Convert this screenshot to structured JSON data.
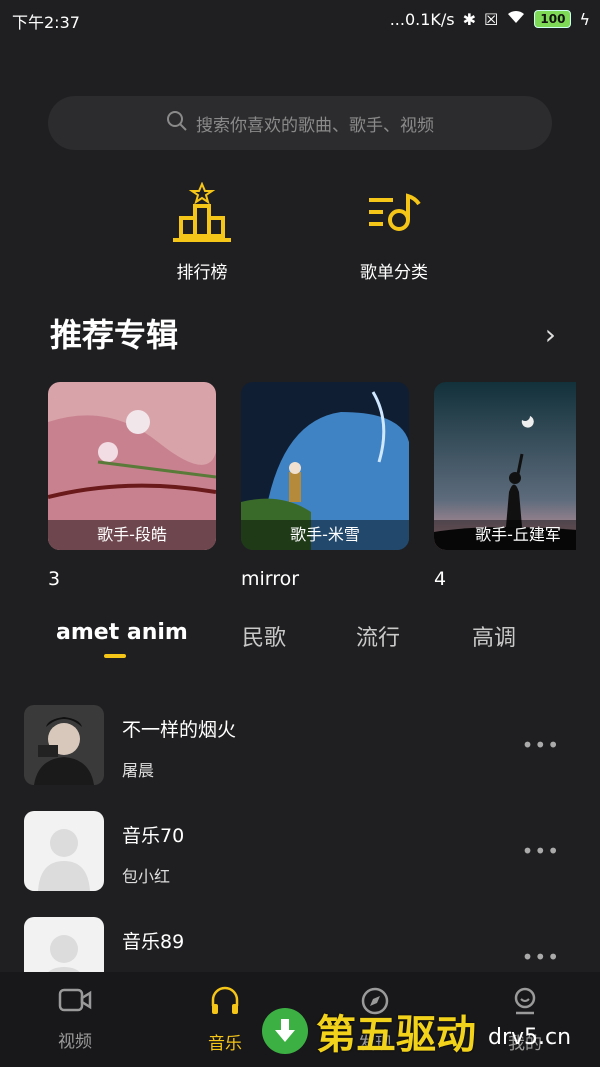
{
  "status_bar": {
    "time": "下午2:37",
    "network_speed": "...0.1K/s",
    "battery": "100"
  },
  "search": {
    "placeholder": "搜索你喜欢的歌曲、歌手、视频"
  },
  "quick_actions": [
    {
      "label": "排行榜",
      "icon": "ranking-podium-icon"
    },
    {
      "label": "歌单分类",
      "icon": "music-category-icon"
    }
  ],
  "recommended": {
    "title": "推荐专辑",
    "albums": [
      {
        "caption": "歌手-段皓",
        "title": "3"
      },
      {
        "caption": "歌手-米雪",
        "title": "mirror"
      },
      {
        "caption": "歌手-丘建军",
        "title": "4"
      }
    ]
  },
  "tabs": [
    "amet anim",
    "民歌",
    "流行",
    "高调"
  ],
  "songs": [
    {
      "name": "不一样的烟火",
      "artist": "屠晨"
    },
    {
      "name": "音乐70",
      "artist": "包小红"
    },
    {
      "name": "音乐89",
      "artist": ""
    }
  ],
  "bottom_nav": [
    {
      "label": "视频",
      "icon": "video-icon"
    },
    {
      "label": "音乐",
      "icon": "headphones-icon"
    },
    {
      "label": "发现",
      "icon": "compass-icon"
    },
    {
      "label": "我的",
      "icon": "profile-icon"
    }
  ],
  "watermark": {
    "text": "第五驱动",
    "url": "drv5.cn"
  },
  "colors": {
    "accent": "#f5c518",
    "background": "#1f1f21"
  }
}
